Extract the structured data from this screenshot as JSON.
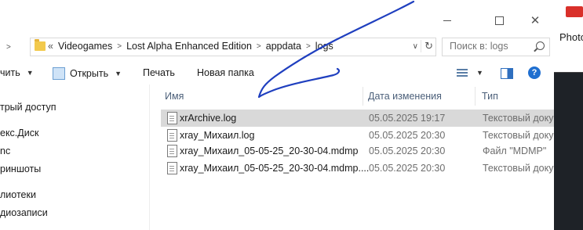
{
  "address": {
    "lead": "«",
    "crumbs": [
      "Videogames",
      "Lost Alpha Enhanced Edition",
      "appdata",
      "logs"
    ]
  },
  "search": {
    "placeholder": "Поиск в: logs"
  },
  "toolbar": {
    "organize": "чить",
    "open": "Открыть",
    "print": "Печать",
    "new_folder": "Новая папка"
  },
  "sidebar": {
    "items": [
      "трый доступ",
      "екс.Диск",
      "nc",
      "риншоты",
      "лиотеки",
      "диозаписи"
    ]
  },
  "columns": {
    "name": "Имя",
    "date": "Дата изменения",
    "type": "Тип"
  },
  "files": [
    {
      "name": "xrArchive.log",
      "date": "05.05.2025 19:17",
      "type": "Текстовый докум"
    },
    {
      "name": "xray_Михаил.log",
      "date": "05.05.2025 20:30",
      "type": "Текстовый докум"
    },
    {
      "name": "xray_Михаил_05-05-25_20-30-04.mdmp",
      "date": "05.05.2025 20:30",
      "type": "Файл \"MDMP\""
    },
    {
      "name": "xray_Михаил_05-05-25_20-30-04.mdmp....",
      "date": "05.05.2025 20:30",
      "type": "Текстовый докум"
    }
  ],
  "background_window": {
    "title": "Photo"
  },
  "colors": {
    "selected_row": "#d9d9d9",
    "ink": "#1f3fbf",
    "help": "#1f6fd0"
  }
}
